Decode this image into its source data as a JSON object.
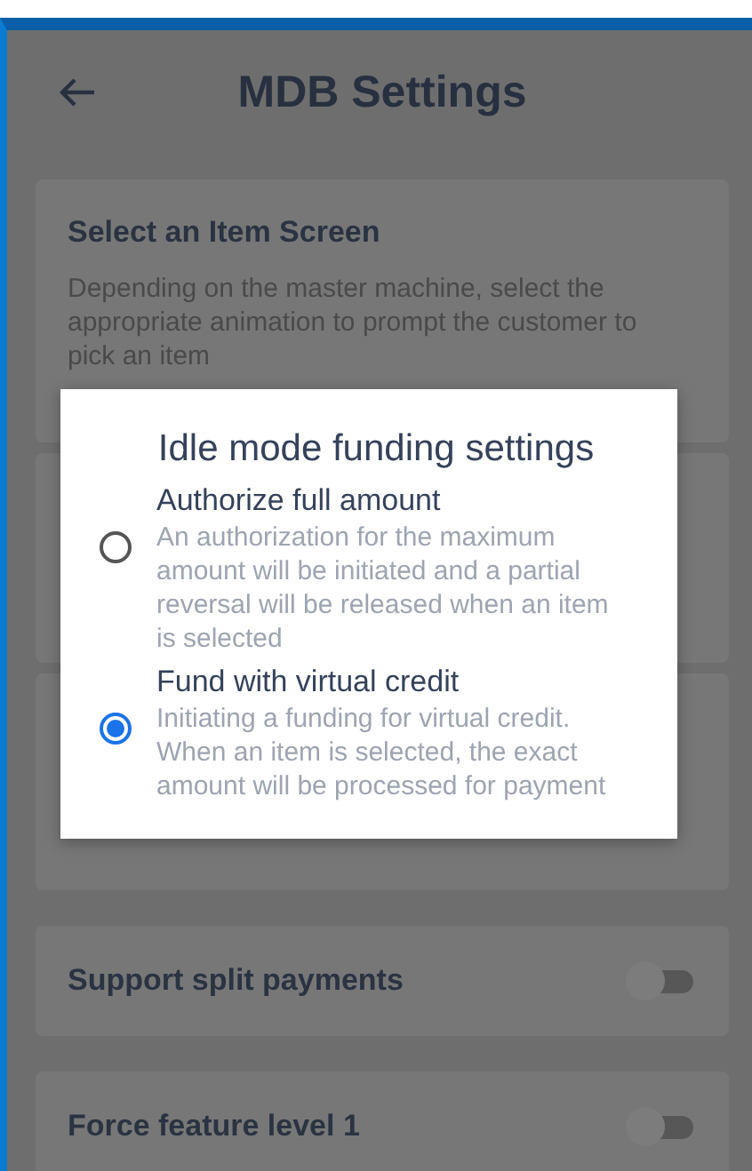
{
  "header": {
    "title": "MDB Settings"
  },
  "settings": [
    {
      "kind": "info",
      "title": "Select an Item Screen",
      "description": "Depending on the master machine, select the appropriate animation to prompt the customer to pick an item"
    },
    {
      "kind": "hidden"
    },
    {
      "kind": "hidden"
    },
    {
      "kind": "toggle",
      "title": "Support split payments",
      "on": false
    },
    {
      "kind": "toggle",
      "title": "Force feature level 1",
      "on": false
    }
  ],
  "dialog": {
    "title": "Idle mode funding settings",
    "options": [
      {
        "label": "Authorize full amount",
        "description": "An authorization for the maximum amount will be initiated and a partial reversal will be released when an item is selected",
        "selected": false
      },
      {
        "label": "Fund with virtual credit",
        "description": "Initiating a funding for virtual credit. When an item is selected, the exact amount will be processed for payment",
        "selected": true
      }
    ]
  }
}
